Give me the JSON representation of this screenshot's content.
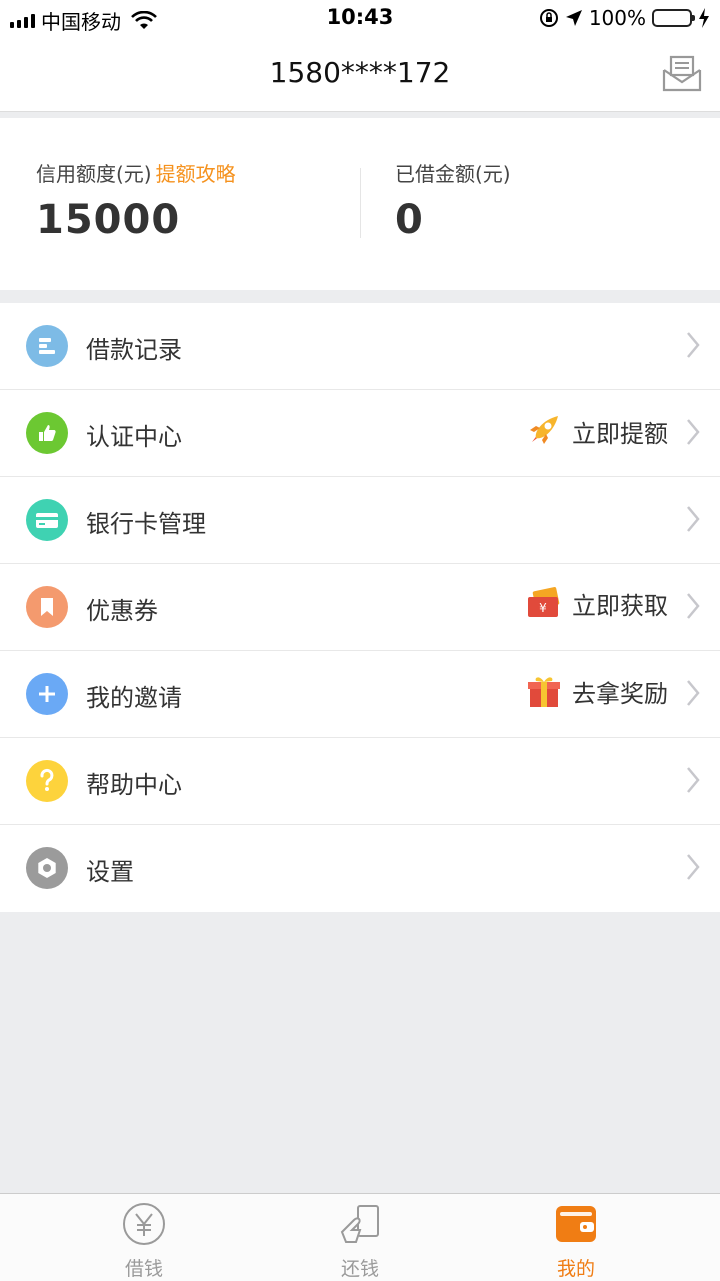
{
  "status_bar": {
    "carrier": "中国移动",
    "time": "10:43",
    "battery": "100%"
  },
  "header": {
    "title": "1580****172"
  },
  "stats": {
    "credit_label": "信用额度(元)",
    "credit_link": "提额攻略",
    "credit_value": "15000",
    "borrowed_label": "已借金额(元)",
    "borrowed_value": "0"
  },
  "menu": [
    {
      "label": "借款记录",
      "icon": "loan-record-icon",
      "color": "#7dbbe6",
      "right_text": ""
    },
    {
      "label": "认证中心",
      "icon": "thumbs-up-icon",
      "color": "#6cc832",
      "right_text": "立即提额",
      "right_icon": "rocket-icon"
    },
    {
      "label": "银行卡管理",
      "icon": "bank-card-icon",
      "color": "#3fd2b2",
      "right_text": ""
    },
    {
      "label": "优惠券",
      "icon": "bookmark-icon",
      "color": "#f49a6e",
      "right_text": "立即获取",
      "right_icon": "coupon-icon"
    },
    {
      "label": "我的邀请",
      "icon": "plus-icon",
      "color": "#6aa9f5",
      "right_text": "去拿奖励",
      "right_icon": "gift-icon"
    },
    {
      "label": "帮助中心",
      "icon": "question-icon",
      "color": "#fdd33c",
      "right_text": ""
    },
    {
      "label": "设置",
      "icon": "gear-icon",
      "color": "#9b9b9b",
      "right_text": ""
    }
  ],
  "tabbar": {
    "tabs": [
      {
        "label": "借钱",
        "icon": "yen-icon",
        "active": false
      },
      {
        "label": "还钱",
        "icon": "repay-icon",
        "active": false
      },
      {
        "label": "我的",
        "icon": "wallet-icon",
        "active": true
      }
    ]
  },
  "colors": {
    "accent": "#f07d14",
    "link": "#f5921e",
    "background": "#ecedef"
  }
}
